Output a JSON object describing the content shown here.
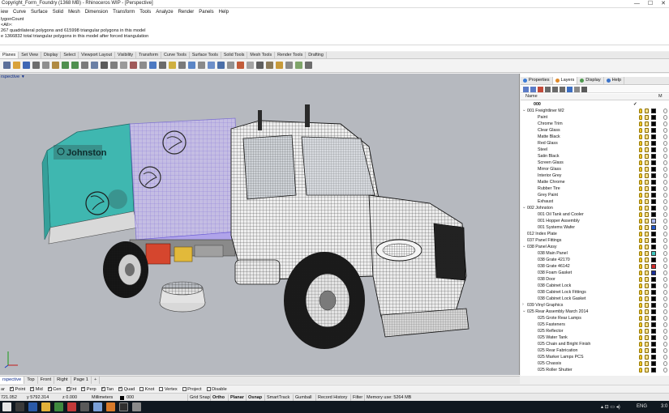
{
  "window": {
    "title": "Copyright_Form_Foundry (1368 MB) - Rhinoceros WIP - [Perspective]",
    "controls": [
      "—",
      "☐",
      "✕"
    ]
  },
  "menu": [
    "iew",
    "Curve",
    "Surface",
    "Solid",
    "Mesh",
    "Dimension",
    "Transform",
    "Tools",
    "Analyze",
    "Render",
    "Panels",
    "Help"
  ],
  "command_history": [
    "lygonCount",
    "<All>:",
    "267 quadrilateral polygons and 615998 triangular polygons in this model",
    "e 1366832 total triangular polygons in this model after forced triangulation"
  ],
  "command_prompt": "",
  "toolbar_tabs": [
    "Planes",
    "Set View",
    "Display",
    "Select",
    "Viewport Layout",
    "Visibility",
    "Transform",
    "Curve Tools",
    "Surface Tools",
    "Solid Tools",
    "Mesh Tools",
    "Render Tools",
    "Drafting"
  ],
  "toolbar_active_tab": 0,
  "viewport": {
    "label": "rspective",
    "caret": "▼"
  },
  "panel": {
    "tabs": [
      {
        "label": "Properties",
        "color": "#3b7bd6"
      },
      {
        "label": "Layers",
        "color": "#e08a2a"
      },
      {
        "label": "Display",
        "color": "#4f9a4f"
      },
      {
        "label": "Help",
        "color": "#3a72c9"
      }
    ],
    "active_tab": 1,
    "column_name": "Name",
    "column_m": "M"
  },
  "layers": [
    {
      "name": "000",
      "level": 0,
      "expander": "",
      "current": true,
      "color": "",
      "check": "✓"
    },
    {
      "name": "001 Freightliner M2",
      "level": 0,
      "expander": "⌄",
      "color": "#000000"
    },
    {
      "name": "Paint",
      "level": 1,
      "color": "#000000"
    },
    {
      "name": "Chrome Trim",
      "level": 1,
      "color": "#000000"
    },
    {
      "name": "Clear Glass",
      "level": 1,
      "color": "#000000"
    },
    {
      "name": "Matte Black",
      "level": 1,
      "color": "#000000"
    },
    {
      "name": "Red Glass",
      "level": 1,
      "color": "#000000"
    },
    {
      "name": "Steel",
      "level": 1,
      "color": "#000000"
    },
    {
      "name": "Satin Black",
      "level": 1,
      "color": "#000000"
    },
    {
      "name": "Screen Glass",
      "level": 1,
      "color": "#000000"
    },
    {
      "name": "Mirror Glass",
      "level": 1,
      "color": "#000000"
    },
    {
      "name": "Interior Grey",
      "level": 1,
      "color": "#000000"
    },
    {
      "name": "Matte Chrome",
      "level": 1,
      "color": "#000000"
    },
    {
      "name": "Rubber Tire",
      "level": 1,
      "color": "#000000"
    },
    {
      "name": "Grey Paint",
      "level": 1,
      "color": "#000000"
    },
    {
      "name": "Exhaust",
      "level": 1,
      "color": "#000000"
    },
    {
      "name": "002 Johnston",
      "level": 0,
      "expander": "⌄",
      "color": "#000000"
    },
    {
      "name": "001 Oil Tank and Cooler",
      "level": 1,
      "color": "#000000"
    },
    {
      "name": "001 Hopper Assembly",
      "level": 1,
      "color": "#aab8ee"
    },
    {
      "name": "001 Systems Wafer",
      "level": 1,
      "color": "#2458c8"
    },
    {
      "name": "012 Index Plate",
      "level": 0,
      "color": "#000000"
    },
    {
      "name": "037 Panel Fittings",
      "level": 0,
      "color": "#000000"
    },
    {
      "name": "038 Panel Assy",
      "level": 0,
      "expander": "⌄",
      "color": "#000000"
    },
    {
      "name": "038 Main Panel",
      "level": 1,
      "color": "#3ec7c0"
    },
    {
      "name": "038 Grate 42170",
      "level": 1,
      "color": "#000000"
    },
    {
      "name": "038 Grate 46142",
      "level": 1,
      "color": "#d42a2a"
    },
    {
      "name": "038 Foam Gasket",
      "level": 1,
      "color": "#1a2f9a"
    },
    {
      "name": "038 Door",
      "level": 1,
      "color": "#000000"
    },
    {
      "name": "038 Cabinet Lock",
      "level": 1,
      "color": "#000000"
    },
    {
      "name": "038 Cabinet Lock Fittings",
      "level": 1,
      "color": "#000000"
    },
    {
      "name": "038 Cabinet Lock Gasket",
      "level": 1,
      "color": "#000000"
    },
    {
      "name": "039 Vinyl Graphics",
      "level": 0,
      "expander": "›",
      "color": "#000000"
    },
    {
      "name": "025 Rear Assembly March 2014",
      "level": 0,
      "expander": "⌄",
      "color": "#000000"
    },
    {
      "name": "025 Grote Rear Lamps",
      "level": 1,
      "color": "#000000"
    },
    {
      "name": "025 Fasteners",
      "level": 1,
      "color": "#000000"
    },
    {
      "name": "025 Reflector",
      "level": 1,
      "color": "#000000"
    },
    {
      "name": "025 Water Tank",
      "level": 1,
      "color": "#000000"
    },
    {
      "name": "025 Chain and Bright Finish",
      "level": 1,
      "color": "#000000"
    },
    {
      "name": "025 Rear Fabrication",
      "level": 1,
      "color": "#000000"
    },
    {
      "name": "025 Marker Lamps PCS",
      "level": 1,
      "color": "#000000"
    },
    {
      "name": "025 Chassis",
      "level": 1,
      "color": "#000000"
    },
    {
      "name": "025 Roller Shutter",
      "level": 1,
      "color": "#000000"
    }
  ],
  "view_tabs": [
    "rspective",
    "Top",
    "Front",
    "Right",
    "Page 1",
    "+"
  ],
  "view_active": 0,
  "osnaps": [
    {
      "label": "ar",
      "checked": false,
      "nobox": true
    },
    {
      "label": "Point",
      "checked": true
    },
    {
      "label": "Mid",
      "checked": true
    },
    {
      "label": "Cen",
      "checked": true
    },
    {
      "label": "Int",
      "checked": true
    },
    {
      "label": "Perp",
      "checked": true
    },
    {
      "label": "Tan",
      "checked": true
    },
    {
      "label": "Quad",
      "checked": true
    },
    {
      "label": "Knot",
      "checked": false
    },
    {
      "label": "Vertex",
      "checked": false
    },
    {
      "label": "Project",
      "checked": false
    },
    {
      "label": "Disable",
      "checked": false
    }
  ],
  "status": {
    "x": "721.052",
    "y": "y 5792.314",
    "z": "z 0.000",
    "units": "Millimeters",
    "layer": "000",
    "panes": [
      {
        "label": "Grid Snap",
        "bold": false
      },
      {
        "label": "Ortho",
        "bold": true
      },
      {
        "label": "Planar",
        "bold": true
      },
      {
        "label": "Osnap",
        "bold": true
      },
      {
        "label": "SmartTrack",
        "bold": false
      },
      {
        "label": "Gumball",
        "bold": false
      },
      {
        "label": "Record History",
        "bold": false
      },
      {
        "label": "Filter",
        "bold": false
      },
      {
        "label": "Memory use: 5264 MB",
        "bold": false
      }
    ]
  },
  "taskbar": {
    "lang": "ENG",
    "clock": "3:0"
  },
  "colors": {
    "viewport_bg": "#b6b9bf",
    "teal_body": "#3fb7b0",
    "hopper_purple": "#a99be8",
    "accent_blue": "#0a2a8a"
  }
}
